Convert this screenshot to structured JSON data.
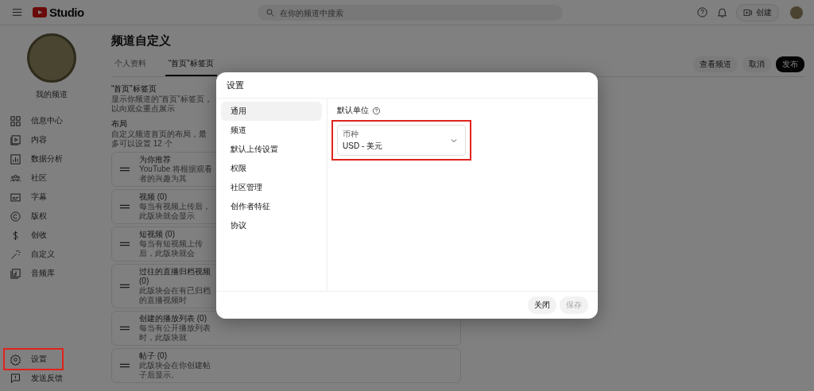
{
  "header": {
    "logo": "Studio",
    "search": {
      "placeholder": "在你的频道中搜索"
    },
    "create_button": "创建"
  },
  "sidebar": {
    "channel_name": "我的频道",
    "items": [
      {
        "label": "信息中心",
        "highlighted": false
      },
      {
        "label": "内容",
        "highlighted": false
      },
      {
        "label": "数据分析",
        "highlighted": false
      },
      {
        "label": "社区",
        "highlighted": false
      },
      {
        "label": "字幕",
        "highlighted": false
      },
      {
        "label": "版权",
        "highlighted": false
      },
      {
        "label": "创收",
        "highlighted": false
      },
      {
        "label": "自定义",
        "highlighted": false
      },
      {
        "label": "音频库",
        "highlighted": false
      }
    ],
    "bottom_items": [
      {
        "label": "设置",
        "highlighted": true
      },
      {
        "label": "发送反馈",
        "highlighted": false
      }
    ]
  },
  "page": {
    "title": "频道自定义",
    "tabs": [
      {
        "label": "个人资料",
        "selected": false
      },
      {
        "label": "“首页”标签页",
        "selected": true
      }
    ],
    "buttons": [
      {
        "label": "查看频道",
        "kind": "secondary"
      },
      {
        "label": "取消",
        "kind": "secondary"
      },
      {
        "label": "发布",
        "kind": "primary"
      }
    ],
    "section_title": "“首页”标签页",
    "section_description": "显示你频道的“首页”标签页，以向观众重点展示",
    "layout_title": "布局",
    "layout_description": "自定义频道首页的布局，最多可以设置 12 个",
    "layout_items": [
      {
        "title": "为你推荐",
        "description": "YouTube 将根据观看者的兴趣为其"
      },
      {
        "title": "视频 (0)",
        "description": "每当有视频上传后，此版块就会显示"
      },
      {
        "title": "短视频 (0)",
        "description": "每当有短视频上传后，此版块就会"
      },
      {
        "title": "过往的直播归档视频 (0)",
        "description": "此版块会在有已归档的直播视频时"
      },
      {
        "title": "创建的播放列表 (0)",
        "description": "每当有公开播放列表时，此版块就"
      },
      {
        "title": "帖子 (0)",
        "description": "此版块会在你创建帖子后显示。"
      }
    ]
  },
  "dialog": {
    "title": "设置",
    "nav": [
      {
        "label": "通用",
        "selected": true
      },
      {
        "label": "频道",
        "selected": false
      },
      {
        "label": "默认上传设置",
        "selected": false
      },
      {
        "label": "权限",
        "selected": false
      },
      {
        "label": "社区管理",
        "selected": false
      },
      {
        "label": "创作者特征",
        "selected": false
      },
      {
        "label": "协议",
        "selected": false
      }
    ],
    "section_label": "默认单位",
    "currency_select": {
      "label": "币种",
      "value": "USD - 美元",
      "highlighted": true
    },
    "buttons": [
      {
        "label": "关闭",
        "disabled": false
      },
      {
        "label": "保存",
        "disabled": true
      }
    ]
  }
}
